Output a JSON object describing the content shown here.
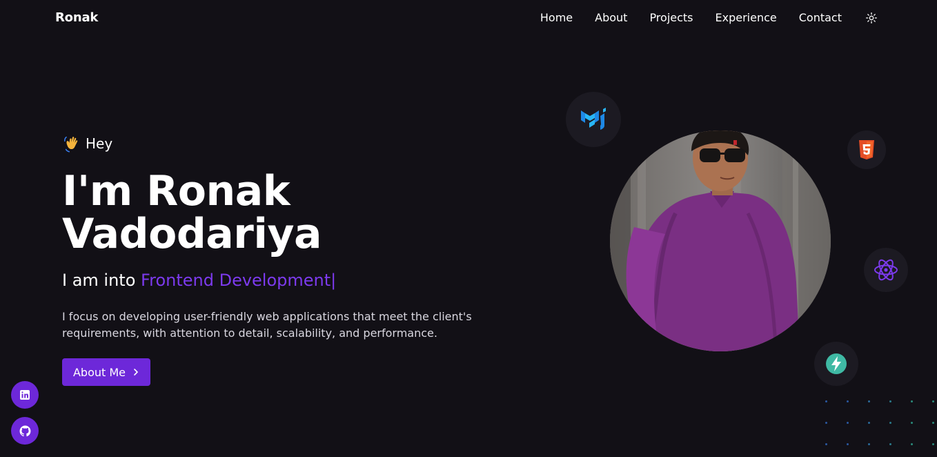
{
  "brand": "Ronak",
  "nav": {
    "items": [
      "Home",
      "About",
      "Projects",
      "Experience",
      "Contact"
    ],
    "theme_icon": "sun-icon"
  },
  "hero": {
    "greeting": "Hey",
    "greeting_icon": "waving-hand-icon",
    "title_line1": "I'm Ronak",
    "title_line2": "Vadodariya",
    "tagline_prefix": "I am into",
    "tagline_highlight": "Frontend Development",
    "tagline_caret": "|",
    "description": "I focus on developing user-friendly web applications that meet the client's requirements, with attention to detail, scalability, and performance.",
    "cta_label": "About Me",
    "cta_icon": "chevron-right-icon"
  },
  "socials": [
    {
      "name": "linkedin",
      "icon": "linkedin-icon"
    },
    {
      "name": "github",
      "icon": "github-icon"
    }
  ],
  "tech_icons": [
    "mui-icon",
    "html5-icon",
    "react-icon",
    "fastapi-icon"
  ],
  "colors": {
    "background": "#121016",
    "accent": "#7c3aed",
    "button": "#6d28d9",
    "text": "#ffffff",
    "muted": "#d9d7e0"
  }
}
